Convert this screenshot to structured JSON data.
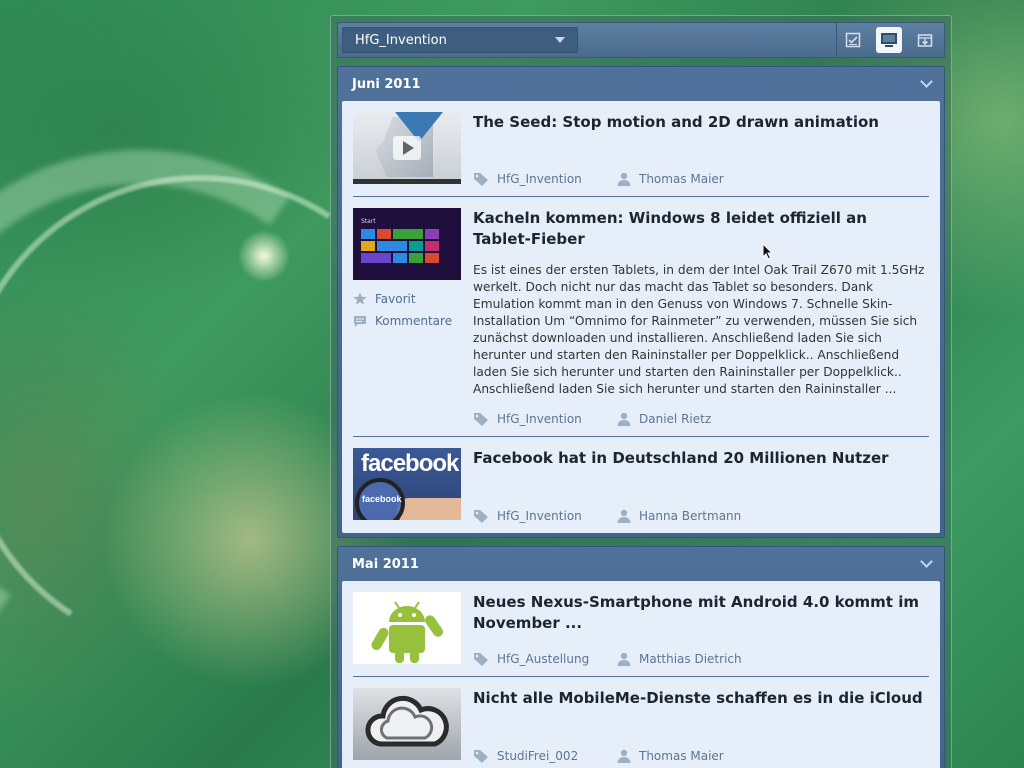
{
  "toolbar": {
    "dropdown_value": "HfG_Invention",
    "icons": [
      "checklist-icon",
      "monitor-icon",
      "download-box-icon"
    ]
  },
  "sections": [
    {
      "title": "Juni 2011",
      "items": [
        {
          "title": "The Seed:  Stop motion and 2D drawn animation",
          "tag": "HfG_Invention",
          "author": "Thomas Maier"
        },
        {
          "title": "Kacheln kommen:  Windows 8 leidet offiziell an Tablet-Fieber",
          "excerpt": "Es ist eines der ersten Tablets, in dem der Intel Oak Trail Z670 mit 1.5GHz werkelt. Doch nicht nur das macht das Tablet so besonders. Dank Emulation kommt man in den Genuss von Windows 7. Schnelle Skin-Installation Um “Omnimo for Rainmeter” zu verwenden, müssen Sie sich zunächst  downloaden und installieren. Anschließend laden Sie sich herunter und starten den Raininstaller per Doppelklick.. Anschließend laden Sie sich herunter und starten den Raininstaller per Doppelklick.. Anschließend laden Sie sich herunter und starten den Raininstaller ...",
          "favorite_label": "Favorit",
          "comments_label": "Kommentare",
          "thumb_label": "Start",
          "tag": "HfG_Invention",
          "author": "Daniel Rietz"
        },
        {
          "title": "Facebook hat in Deutschland 20 Millionen Nutzer",
          "thumb_word": "facebook",
          "thumb_lens_word": "facebook",
          "tag": "HfG_Invention",
          "author": "Hanna Bertmann"
        }
      ]
    },
    {
      "title": "Mai 2011",
      "items": [
        {
          "title": "Neues Nexus-Smartphone mit Android 4.0 kommt im November ...",
          "tag": "HfG_Austellung",
          "author": "Matthias Dietrich"
        },
        {
          "title": "Nicht alle MobileMe-Dienste schaffen es in die iCloud",
          "tag": "StudiFrei_002",
          "author": "Thomas Maier"
        }
      ]
    }
  ],
  "colors": {
    "accent": "#4a6b8d",
    "panel": "#e6eff9",
    "meta_text": "#5c7592"
  }
}
